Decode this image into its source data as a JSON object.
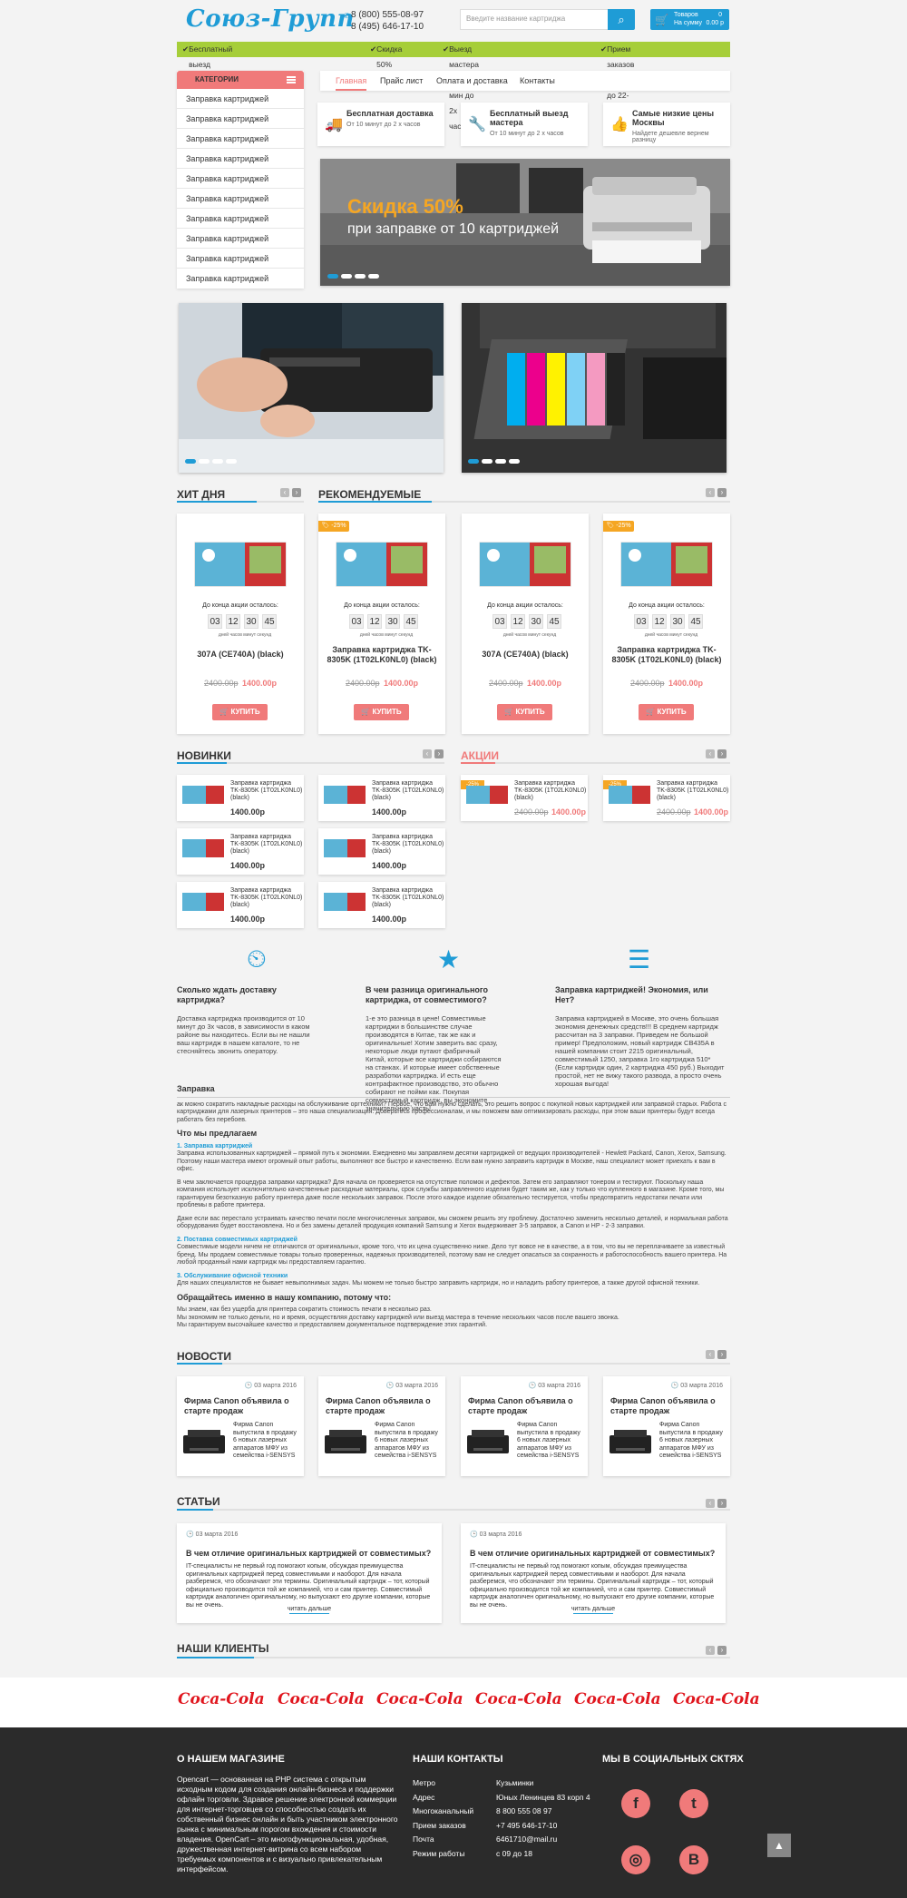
{
  "header": {
    "logo": "Союз-Групп",
    "phone1": "8 (800) 555-08-97",
    "phone2": "8 (495) 646-17-10",
    "search_placeholder": "Введите название картриджа",
    "cart_items_label": "Товаров",
    "cart_items": "0",
    "cart_sum_label": "На сумму",
    "cart_sum": "0.00 р"
  },
  "promos": [
    "Бесплатный выезд мастера от 1 картриджа!",
    "Скидка 50%",
    "Выезд мастера от 10 мин до 2х часов.",
    "Прием заказов с 8-00 до 22-00"
  ],
  "sidebar": {
    "title": "Категории",
    "items": [
      "Заправка картриджей",
      "Заправка картриджей",
      "Заправка картриджей",
      "Заправка картриджей",
      "Заправка картриджей",
      "Заправка картриджей",
      "Заправка картриджей",
      "Заправка картриджей",
      "Заправка картриджей",
      "Заправка картриджей"
    ]
  },
  "nav": [
    "Главная",
    "Прайс лист",
    "Оплата и доставка",
    "Контакты"
  ],
  "features": [
    {
      "title": "Бесплатная доставка",
      "sub": "От 10 минут до 2 х часов"
    },
    {
      "title": "Бесплатный выезд мастера",
      "sub": "От 10 минут до 2 х часов"
    },
    {
      "title": "Самые низкие цены Москвы",
      "sub": "Найдете дешевле вернем разницу"
    }
  ],
  "slider": {
    "line1": "Скидка 50%",
    "line2": "при заправке от 10 картриджей"
  },
  "sections": {
    "hit": "Хит дня",
    "recommended": "Рекомендуемые",
    "new": "Новинки",
    "sale": "Акции",
    "news": "Новости",
    "articles": "Статьи",
    "clients": "Наши клиенты"
  },
  "products": [
    {
      "name": "307A (CE740A) (black)",
      "old": "2400.00р",
      "new": "1400.00р",
      "badge": ""
    },
    {
      "name": "Заправка картриджа TK-8305K (1T02LK0NL0) (black)",
      "old": "2400.00р",
      "new": "1400.00р",
      "badge": "-25%"
    },
    {
      "name": "307A (CE740A) (black)",
      "old": "2400.00р",
      "new": "1400.00р",
      "badge": ""
    },
    {
      "name": "Заправка картриджа TK-8305K (1T02LK0NL0) (black)",
      "old": "2400.00р",
      "new": "1400.00р",
      "badge": "-25%"
    }
  ],
  "timer": {
    "label": "До конца акции осталось:",
    "d": "03",
    "h": "12",
    "m": "30",
    "s": "45",
    "units": "дней   часов   минут   секунд"
  },
  "buy_label": "КУПИТЬ",
  "mini": {
    "name": "Заправка картриджа TK-8305K (1T02LK0NL0) (black)",
    "price": "1400.00р",
    "old": "2400.00р",
    "badge": "-25%"
  },
  "info": [
    {
      "title": "Сколько ждать доставку картриджа?",
      "text": "Доставка картриджа производится от 10 минут до 3х часов, в зависимости в каком районе вы находитесь. Если вы не нашли ваш картридж в нашем каталоге, то не стесняйтесь звонить оператору."
    },
    {
      "title": "В чем разница оригинального картриджа, от совместимого?",
      "text": "1-е это разница в цене! Совместимые картриджи в большинстве случае производятся в Китае, так же как и оригинальные! Хотим заверить вас сразу, некоторые люди путают фабричный Китай, которые все картриджи собираются на станках. И которые имеет собственные разработки картриджа. И есть еще контрафактное производство, это обычно собирают не пойми как. Покупая совместимый картридж, вы экономите значительную часть!"
    },
    {
      "title": "Заправка картриджей! Экономия, или Нет?",
      "text": "Заправка картриджей в Москве, это очень большая экономия денежных средств!!! В среднем картридж рассчитан на 3 заправки. Приведем не большой пример! Предположим, новый картридж CB435A в нашей компании стоит 2215 оригинальный, совместимый 1250, заправка 1го картриджа 510* (Если картридж один, 2 картриджа 450 руб.) Выходит простой, нет не вижу такого развода, а просто очень хорошая выгода!"
    }
  ],
  "article": {
    "title": "Заправка",
    "intro": "ак можно сократить накладные расходы на обслуживание оргтехники? Первое, что вам нужно сделать, это решить вопрос с покупкой новых картриджей или заправкой старых. Работа с картриджами для лазерных принтеров – это наша специализация. Доверьтесь профессионалам, и мы поможем вам оптимизировать расходы, при этом ваши принтеры будут всегда работать без перебоев.",
    "offer": "Что мы предлагаем",
    "s1": "1. Заправка картриджей",
    "s1t": "Заправка использованных картриджей – прямой путь к экономии. Ежедневно мы заправляем десятки картриджей от ведущих производителей - Hewlett Packard, Canon, Xerox, Samsung. Поэтому наши мастера имеют огромный опыт работы, выполняют все быстро и качественно. Если вам нужно заправить картридж в Москве, наш специалист может приехать к вам в офис.",
    "p2": "В чем заключается процедура заправки картриджа? Для начала он проверяется на отсутствие поломок и дефектов. Затем его заправляют тонером и тестируют. Поскольку наша компания использует исключительно качественные расходные материалы, срок службы заправленного изделия будет таким же, как у только что купленного в магазине. Кроме того, мы гарантируем безотказную работу принтера даже после нескольких заправок. После этого каждое изделие обязательно тестируется, чтобы предотвратить недостатки печати или проблемы в работе принтера.",
    "p3": "Даже если вас перестало устраивать качество печати после многочисленных заправок, мы сможем решить эту проблему. Достаточно заменить несколько деталей, и нормальная работа оборудования будет восстановлена. Но и без замены деталей продукция компаний Samsung и Xerox выдерживает 3-5 заправок, а Canon и HP - 2-3 заправки.",
    "s2": "2. Поставка совместимых картриджей",
    "s2t": "Совместимые модели ничем не отличаются от оригинальных, кроме того, что их цена существенно ниже. Дело тут вовсе не в качестве, а в том, что вы не переплачиваете за известный бренд. Мы продаем совместимые товары только проверенных, надежных производителей, поэтому вам не следует опасаться за сохранность и работоспособность вашего принтера. На любой проданный нами картридж мы предоставляем гарантию.",
    "s3": "3. Обслуживание офисной техники",
    "s3t": "Для наших специалистов не бывает невыполнимых задач. Мы можем не только быстро заправить картридж, но и наладить работу принтеров, а также другой офисной техники.",
    "why": "Обращайтесь именно в нашу компанию, потому что:",
    "w1": "Мы знаем, как без ущерба для принтера сократить стоимость печати в несколько раз.",
    "w2": "Мы экономим не только деньги, но и время, осуществляя доставку картриджей или выезд мастера в течение нескольких часов после вашего звонка.",
    "w3": "Мы гарантируем высочайшее качество и предоставляем документальное подтверждение этих гарантий."
  },
  "news": {
    "date": "03 марта 2016",
    "title": "Фирма Canon объявила о старте продаж",
    "text": "Фирма Canon выпустила в продажу 6 новых лазерных аппаратов МФУ из семейства i-SENSYS"
  },
  "articles": {
    "date": "03 марта 2016",
    "title": "В чем отличие оригинальных картриджей от совместимых?",
    "text": "IT-специалисты не первый год помогают копым, обсуждая преимущества оригинальных картриджей перед совместимыми и наоборот. Для начала разберемся, что обозначают эти термины. Оригинальный картридж – тот, который официально производится той же компанией, что и сам принтер. Совместимый картридж аналогичен оригинальному, но выпускают его другие компании, которые вы не очень.",
    "more": "читать дальше"
  },
  "client_logo": "Coca-Cola",
  "footer": {
    "about_title": "О нашем магазине",
    "about": "Opencart — основанная на PHP система с открытым исходным кодом для создания онлайн-бизнеса и поддержки офлайн торговли. Здравое решение электронной коммерции для интернет-торговцев со способностью создать их собственный бизнес онлайн и быть участником электронного рынка с минимальным порогом вхождения и стоимости владения. OpenCart – это многофункциональная, удобная, дружественная интернет-витрина со всем набором требуемых компонентов и с визуально привлекательным интерфейсом.",
    "contacts_title": "Наши контакты",
    "contact_labels": [
      "Метро",
      "Адрес",
      "Многоканальный",
      "Прием заказов",
      "Почта",
      "Режим работы"
    ],
    "contact_values": [
      "Кузьминки",
      "Юных Ленинцев 83 корп 4",
      "8 800 555 08 97",
      "+7 495 646-17-10",
      "6461710@mail.ru",
      "с 09 до 18"
    ],
    "social_title": "Мы в социальных сктях"
  }
}
